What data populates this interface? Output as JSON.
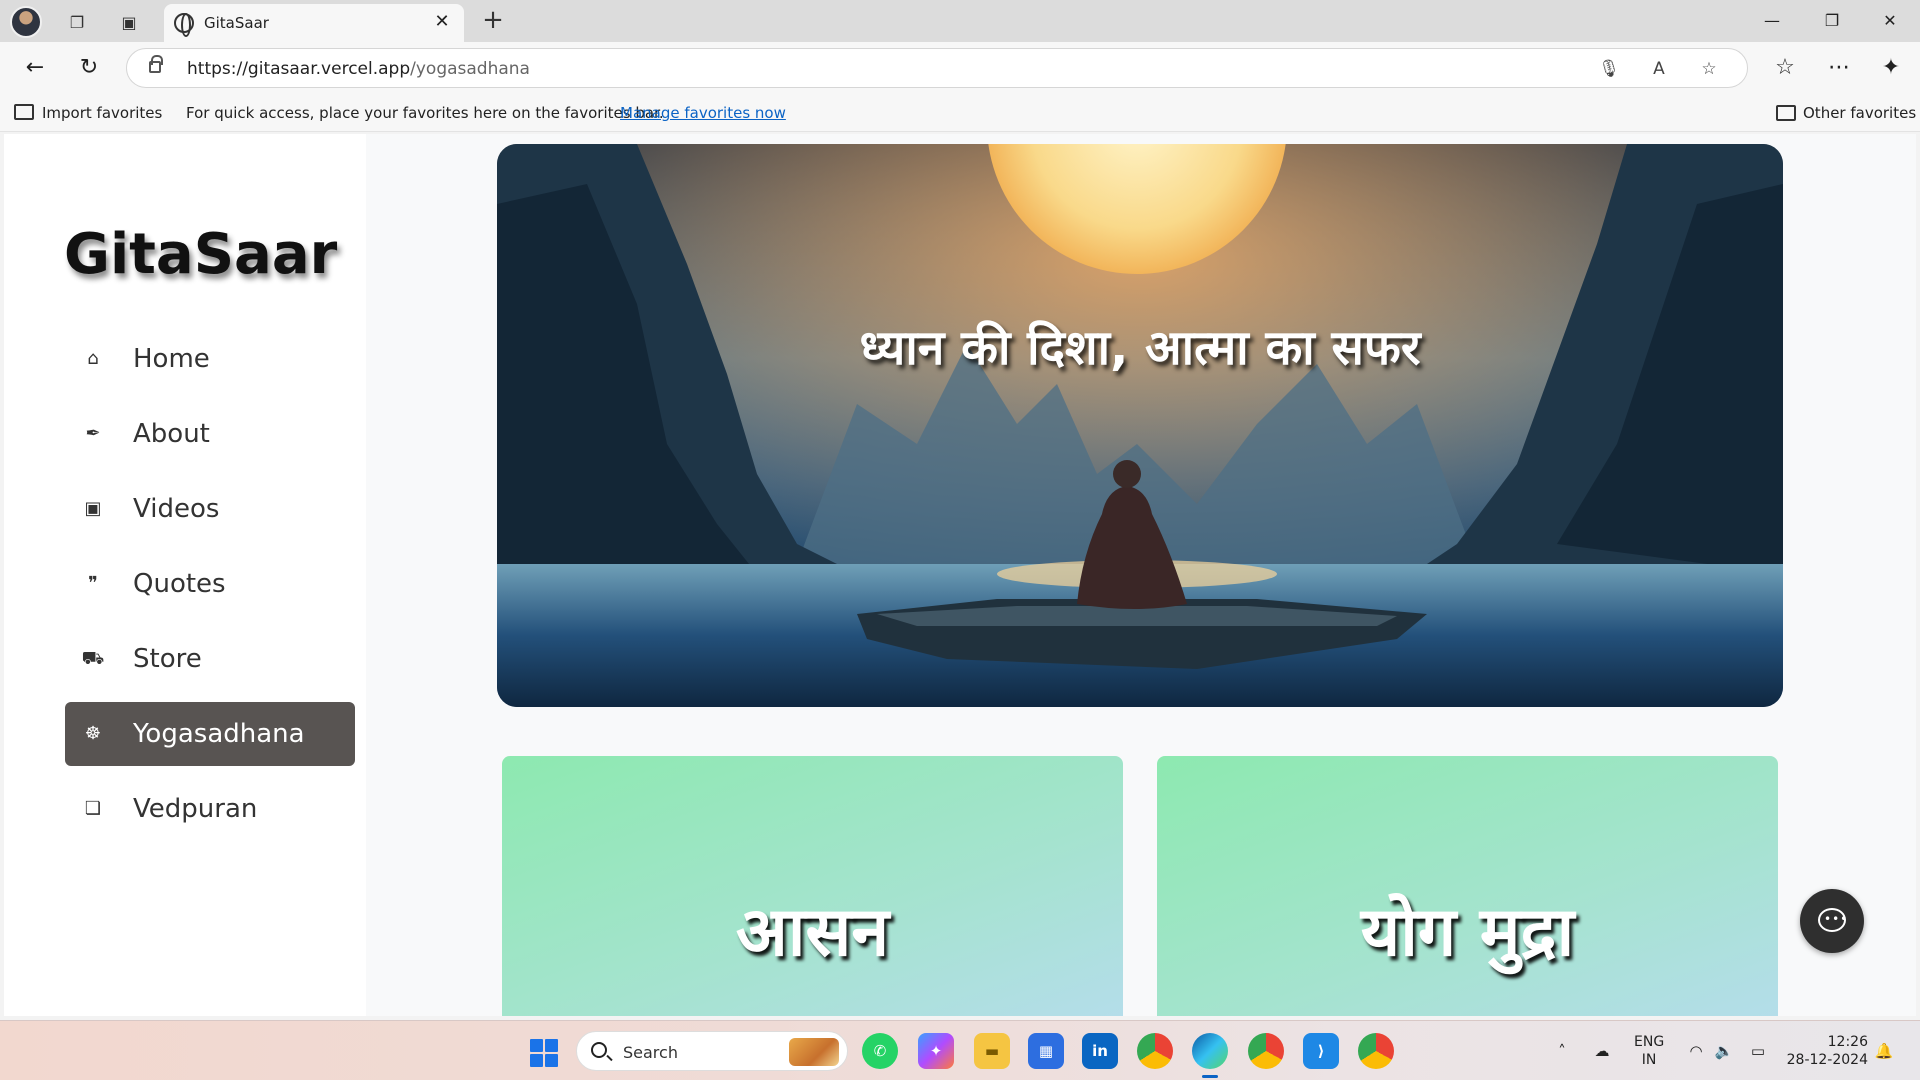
{
  "browser": {
    "tab_title": "GitaSaar",
    "url_host": "https://gitasaar.vercel.app",
    "url_path": "/yogasadhana",
    "favorites": {
      "import_label": "Import favorites",
      "message": "For quick access, place your favorites here on the favorites bar.",
      "manage_link": "Manage favorites now",
      "other_label": "Other favorites"
    }
  },
  "site": {
    "brand": "GitaSaar",
    "nav": [
      {
        "label": "Home",
        "icon": "home-icon"
      },
      {
        "label": "About",
        "icon": "feather-icon"
      },
      {
        "label": "Videos",
        "icon": "video-icon"
      },
      {
        "label": "Quotes",
        "icon": "quote-icon"
      },
      {
        "label": "Store",
        "icon": "cart-icon"
      },
      {
        "label": "Yogasadhana",
        "icon": "meditation-icon",
        "active": true
      },
      {
        "label": "Vedpuran",
        "icon": "book-icon"
      }
    ],
    "hero_title": "ध्यान की दिशा, आत्मा का सफर",
    "cards": [
      {
        "title": "आसन"
      },
      {
        "title": "योग मुद्रा"
      }
    ],
    "active_nav_color": "#585452"
  },
  "taskbar": {
    "search_label": "Search",
    "language": "ENG",
    "region": "IN",
    "time": "12:26",
    "date": "28-12-2024"
  }
}
